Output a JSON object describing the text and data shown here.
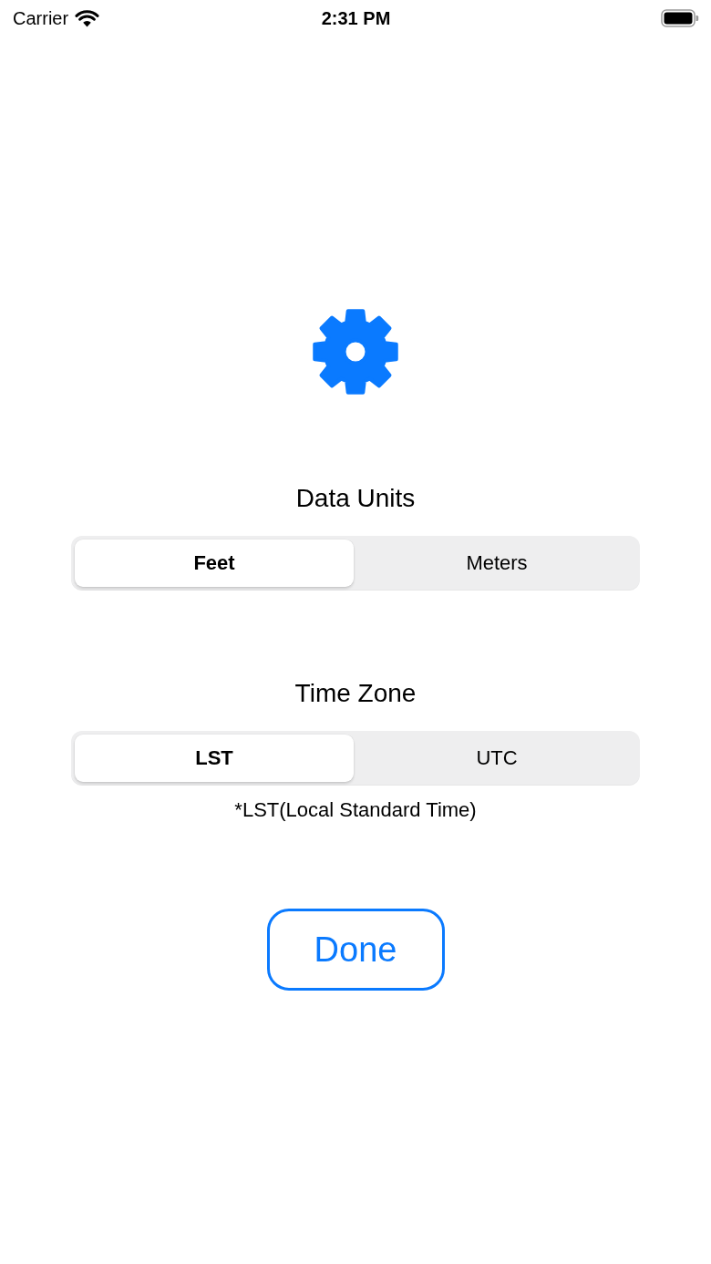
{
  "status_bar": {
    "carrier": "Carrier",
    "time": "2:31 PM"
  },
  "sections": [
    {
      "title": "Data Units",
      "options": [
        {
          "label": "Feet",
          "selected": true
        },
        {
          "label": "Meters",
          "selected": false
        }
      ]
    },
    {
      "title": "Time Zone",
      "options": [
        {
          "label": "LST",
          "selected": true
        },
        {
          "label": "UTC",
          "selected": false
        }
      ],
      "note": "*LST(Local Standard Time)"
    }
  ],
  "done_button": {
    "label": "Done"
  }
}
